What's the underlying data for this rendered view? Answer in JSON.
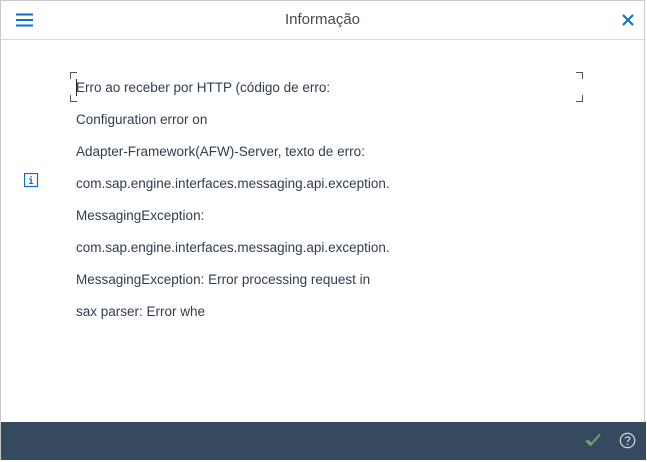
{
  "header": {
    "title": "Informação",
    "menu_icon": "hamburger-menu-icon",
    "close_icon": "close-icon"
  },
  "message": {
    "icon": "info-icon",
    "lines": [
      "Erro ao receber por HTTP (código de erro:",
      "Configuration error on",
      "Adapter-Framework(AFW)-Server, texto de erro:",
      "com.sap.engine.interfaces.messaging.api.exception.",
      "MessagingException:",
      "com.sap.engine.interfaces.messaging.api.exception.",
      "MessagingException: Error processing request in",
      "sax parser: Error whe"
    ]
  },
  "footer": {
    "ok_icon": "checkmark-icon",
    "help_icon": "help-icon"
  },
  "colors": {
    "accent": "#0a6ed1",
    "footer_bg": "#354a5f",
    "text": "#2c3e50",
    "ok_green": "#5fa05f"
  }
}
